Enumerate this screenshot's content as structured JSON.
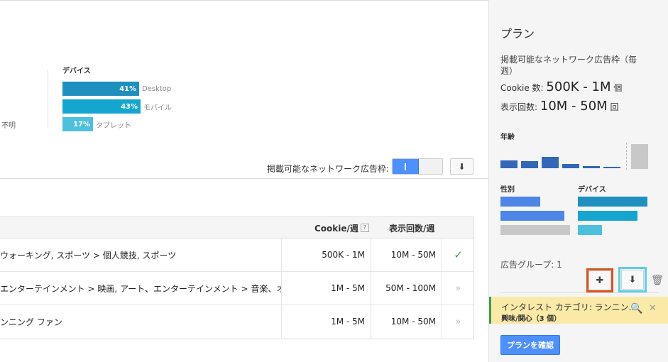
{
  "devices": {
    "unknown_label": "不明",
    "title": "デバイス",
    "rows": [
      {
        "pct": "41%",
        "name": "Desktop",
        "color": "#1f8fc0"
      },
      {
        "pct": "43%",
        "name": "モバイル",
        "color": "#15a6d0"
      },
      {
        "pct": "17%",
        "name": "タブレット",
        "color": "#4cc1de"
      }
    ]
  },
  "toolbar": {
    "toggle_label": "掲載可能なネットワーク広告枠:",
    "download_icon": "download-icon"
  },
  "table": {
    "headers": {
      "cookie": "Cookie/週",
      "impressions": "表示回数/週",
      "help": "?"
    },
    "rows": [
      {
        "name": "ウォーキング, スポーツ > 個人競技, スポーツ",
        "cookie": "500K - 1M",
        "impressions": "10M - 50M",
        "action": "✓"
      },
      {
        "name": "エンターテインメント > 映画, アート、エンターテインメント > 音楽、オ...",
        "cookie": "1M - 5M",
        "impressions": "50M - 100M",
        "action": "»"
      },
      {
        "name": "ンニング ファン",
        "cookie": "1M - 5M",
        "impressions": "10M - 50M",
        "action": "»"
      }
    ]
  },
  "plan": {
    "title": "プラン",
    "inventory_label": "掲載可能なネットワーク広告枠（毎週）",
    "cookie_prefix": "Cookie 数:",
    "cookie_value": "500K - 1M",
    "cookie_unit": "個",
    "imp_prefix": "表示回数:",
    "imp_value": "10M - 50M",
    "imp_unit": "回",
    "age_title": "年齢",
    "gender_title": "性別",
    "device_title": "デバイス",
    "ad_group_label": "広告グループ: 1",
    "ad_group_item": {
      "title": "インタレスト カテゴリ: ランニン...",
      "subtitle": "興味/関心（3 個）"
    },
    "confirm_button": "プランを確認"
  }
}
